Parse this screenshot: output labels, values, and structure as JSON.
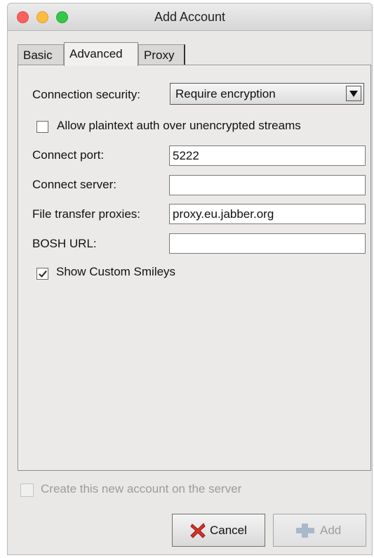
{
  "window": {
    "title": "Add Account"
  },
  "tabs": {
    "basic": "Basic",
    "advanced": "Advanced",
    "proxy": "Proxy"
  },
  "advanced": {
    "connection_security_label": "Connection security:",
    "connection_security_value": "Require encryption",
    "plaintext_auth_label": "Allow plaintext auth over unencrypted streams",
    "plaintext_auth_checked": false,
    "connect_port_label": "Connect port:",
    "connect_port_value": "5222",
    "connect_server_label": "Connect server:",
    "connect_server_value": "",
    "file_transfer_label": "File transfer proxies:",
    "file_transfer_value": "proxy.eu.jabber.org",
    "bosh_url_label": "BOSH URL:",
    "bosh_url_value": "",
    "custom_smileys_label": "Show Custom Smileys",
    "custom_smileys_checked": true
  },
  "footer": {
    "create_on_server_label": "Create this new account on the server",
    "create_on_server_checked": false,
    "cancel_label": "Cancel",
    "add_label": "Add"
  },
  "icons": {
    "cancel": "red-x-icon",
    "add": "plus-icon"
  }
}
